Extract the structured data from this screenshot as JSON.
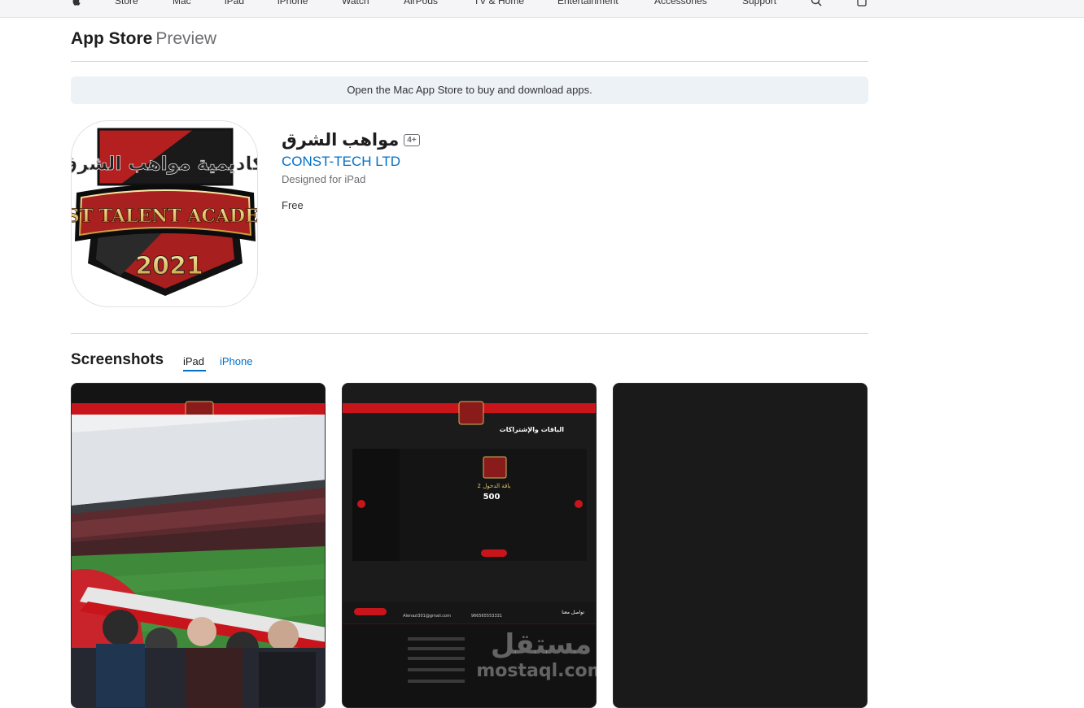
{
  "globalnav": {
    "items": [
      "Store",
      "Mac",
      "iPad",
      "iPhone",
      "Watch",
      "AirPods",
      "TV & Home",
      "Entertainment",
      "Accessories",
      "Support"
    ]
  },
  "localnav": {
    "brand": "App Store",
    "suffix": "Preview"
  },
  "banner": {
    "text": "Open the Mac App Store to buy and download apps."
  },
  "app": {
    "title": "مواهب الشرق",
    "age_rating": "4+",
    "developer": "CONST-TECH LTD",
    "designed_for": "Designed for iPad",
    "price": "Free",
    "icon": {
      "top_text": "أكاديمية مواهب الشرق",
      "ribbon_text": "EAST TALENT ACADEMY",
      "year": "2021"
    }
  },
  "screenshots": {
    "title": "Screenshots",
    "tabs": [
      "iPad",
      "iPhone"
    ],
    "active_tab": "iPad",
    "shot2": {
      "heading": "الباقات والإشتراكات",
      "package_name": "باقة الدخول 2",
      "package_price": "500",
      "contact_heading": "تواصل معنا",
      "email": "Alenazi301@gmail.com",
      "phone": "966565553331"
    }
  },
  "watermark": {
    "arabic": "مستقل",
    "latin": "mostaql.com"
  },
  "colors": {
    "link": "#0070c9",
    "banner_bg": "#edf2f7",
    "accent_red": "#c8151b"
  }
}
